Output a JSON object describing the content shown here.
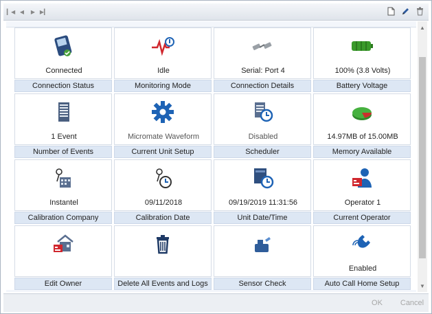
{
  "toolbar": {
    "nav": [
      "first",
      "previous",
      "next",
      "last"
    ],
    "icons": [
      "page-icon",
      "pencil-icon",
      "trash-icon"
    ]
  },
  "tiles": [
    {
      "value": "Connected",
      "label": "Connection Status",
      "icon": "handheld-device-icon"
    },
    {
      "value": "Idle",
      "label": "Monitoring Mode",
      "icon": "heartbeat-icon"
    },
    {
      "value": "Serial: Port 4",
      "label": "Connection Details",
      "icon": "serial-cable-icon"
    },
    {
      "value": "100% (3.8 Volts)",
      "label": "Battery Voltage",
      "icon": "battery-icon"
    },
    {
      "value": "1 Event",
      "label": "Number of Events",
      "icon": "document-stack-icon"
    },
    {
      "value": "Micromate Waveform",
      "label": "Current Unit Setup",
      "icon": "gear-icon"
    },
    {
      "value": "Disabled",
      "label": "Scheduler",
      "icon": "schedule-icon"
    },
    {
      "value": "14.97MB of 15.00MB",
      "label": "Memory Available",
      "icon": "pie-chart-icon"
    },
    {
      "value": "Instantel",
      "label": "Calibration Company",
      "icon": "calibration-company-icon"
    },
    {
      "value": "09/11/2018",
      "label": "Calibration Date",
      "icon": "calibration-date-icon"
    },
    {
      "value": "09/19/2019 11:31:56",
      "label": "Unit Date/Time",
      "icon": "calendar-clock-icon"
    },
    {
      "value": "Operator 1",
      "label": "Current Operator",
      "icon": "operator-icon"
    },
    {
      "value": "",
      "label": "Edit Owner",
      "icon": "owner-house-icon"
    },
    {
      "value": "",
      "label": "Delete All Events and Logs",
      "icon": "trash-can-icon"
    },
    {
      "value": "",
      "label": "Sensor Check",
      "icon": "sensor-check-icon"
    },
    {
      "value": "Enabled",
      "label": "Auto Call Home Setup",
      "icon": "phone-icon"
    }
  ],
  "buttons": {
    "ok": "OK",
    "cancel": "Cancel"
  },
  "colors": {
    "tile_label_bg": "#dde7f4",
    "accent_blue": "#1e63b5",
    "battery_green": "#3a9a2a"
  }
}
